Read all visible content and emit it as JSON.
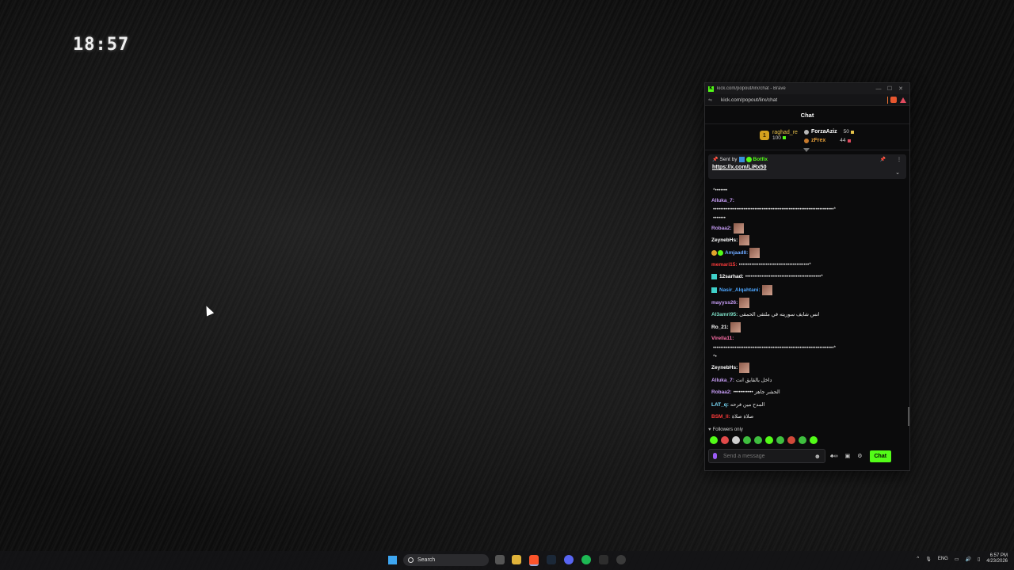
{
  "desktop": {
    "clock": "18:57"
  },
  "browser": {
    "title": "kick.com/popout/lirx/chat - Brave",
    "url": "kick.com/popout/lirx/chat"
  },
  "chat": {
    "header": "Chat",
    "leaderboard": {
      "top": {
        "name": "raghad_re",
        "score": "100"
      },
      "others": [
        {
          "name": "ForzaAziz",
          "points": "50",
          "color": "#ffffff",
          "badge_color": "#b8b8b8"
        },
        {
          "name": "zFrex",
          "points": "44",
          "color": "#e7a03a",
          "badge_color": "#c87a2c"
        }
      ]
    },
    "pinned": {
      "sent_by_label": "Sent by",
      "author": "Botfix",
      "link": "https://x.com/LiRx50"
    },
    "messages": [
      {
        "user": "",
        "color": "#ffffff",
        "text": "*•••••••"
      },
      {
        "user": "Alluka_7:",
        "color": "#c89ef7",
        "text": ""
      },
      {
        "user": "",
        "color": "#ffffff",
        "text": "•••••••••••••••••••••••••••••••••••••••••••••••••••••••••••••••••••*"
      },
      {
        "user": "",
        "color": "#ffffff",
        "text": "•••••••"
      },
      {
        "user": "Robaa2:",
        "color": "#c89ef7",
        "text": ""
      },
      {
        "user": "ZeynebHs:",
        "color": "#ffffff",
        "text": ""
      },
      {
        "user": "Amjaad8:",
        "color": "#6da8ff",
        "text": ""
      },
      {
        "user": "memari15:",
        "color": "#ff3b3b",
        "text": "•••••••••••••••••••••••••••••••••••••••*"
      },
      {
        "user": "12sarhad:",
        "color": "#ffffff",
        "text": "••••••••••••••••••••••••••••••••••••••••••*"
      },
      {
        "user": "Nasir_Alqahtani:",
        "color": "#4da6ff",
        "text": ""
      },
      {
        "user": "mayyss26:",
        "color": "#c89ef7",
        "text": ""
      },
      {
        "user": "Al3amri95:",
        "color": "#7ee0c7",
        "text": "انس شايف سوريته في ملتقى الحمقى"
      },
      {
        "user": "Ro_21:",
        "color": "#ffffff",
        "text": ""
      },
      {
        "user": "Virella11:",
        "color": "#ff6fa8",
        "text": ""
      },
      {
        "user": "",
        "color": "#ffffff",
        "text": "•••••••••••••••••••••••••••••••••••••••••••••••••••••••••••••••••••*"
      },
      {
        "user": "",
        "color": "#ffffff",
        "text": "*•"
      },
      {
        "user": "ZeynebHs:",
        "color": "#ffffff",
        "text": ""
      },
      {
        "user": "Alluka_7:",
        "color": "#c89ef7",
        "text": "داخل بالقايق انت"
      },
      {
        "user": "Robaa2:",
        "color": "#c89ef7",
        "text": "••••••••••• الحشر جاهز"
      },
      {
        "user": "LAT_q:",
        "color": "#7ee0ff",
        "text": "المدح مين فرحه"
      },
      {
        "user": "BSM_ll:",
        "color": "#ff3b3b",
        "text": "صلاة صلاة"
      }
    ],
    "followers_only": "Followers only",
    "input_placeholder": "Send a message",
    "chat_button": "Chat"
  },
  "taskbar": {
    "search_label": "Search",
    "language": "ENG",
    "time": "6:57 PM",
    "date": "4/23/2026"
  }
}
